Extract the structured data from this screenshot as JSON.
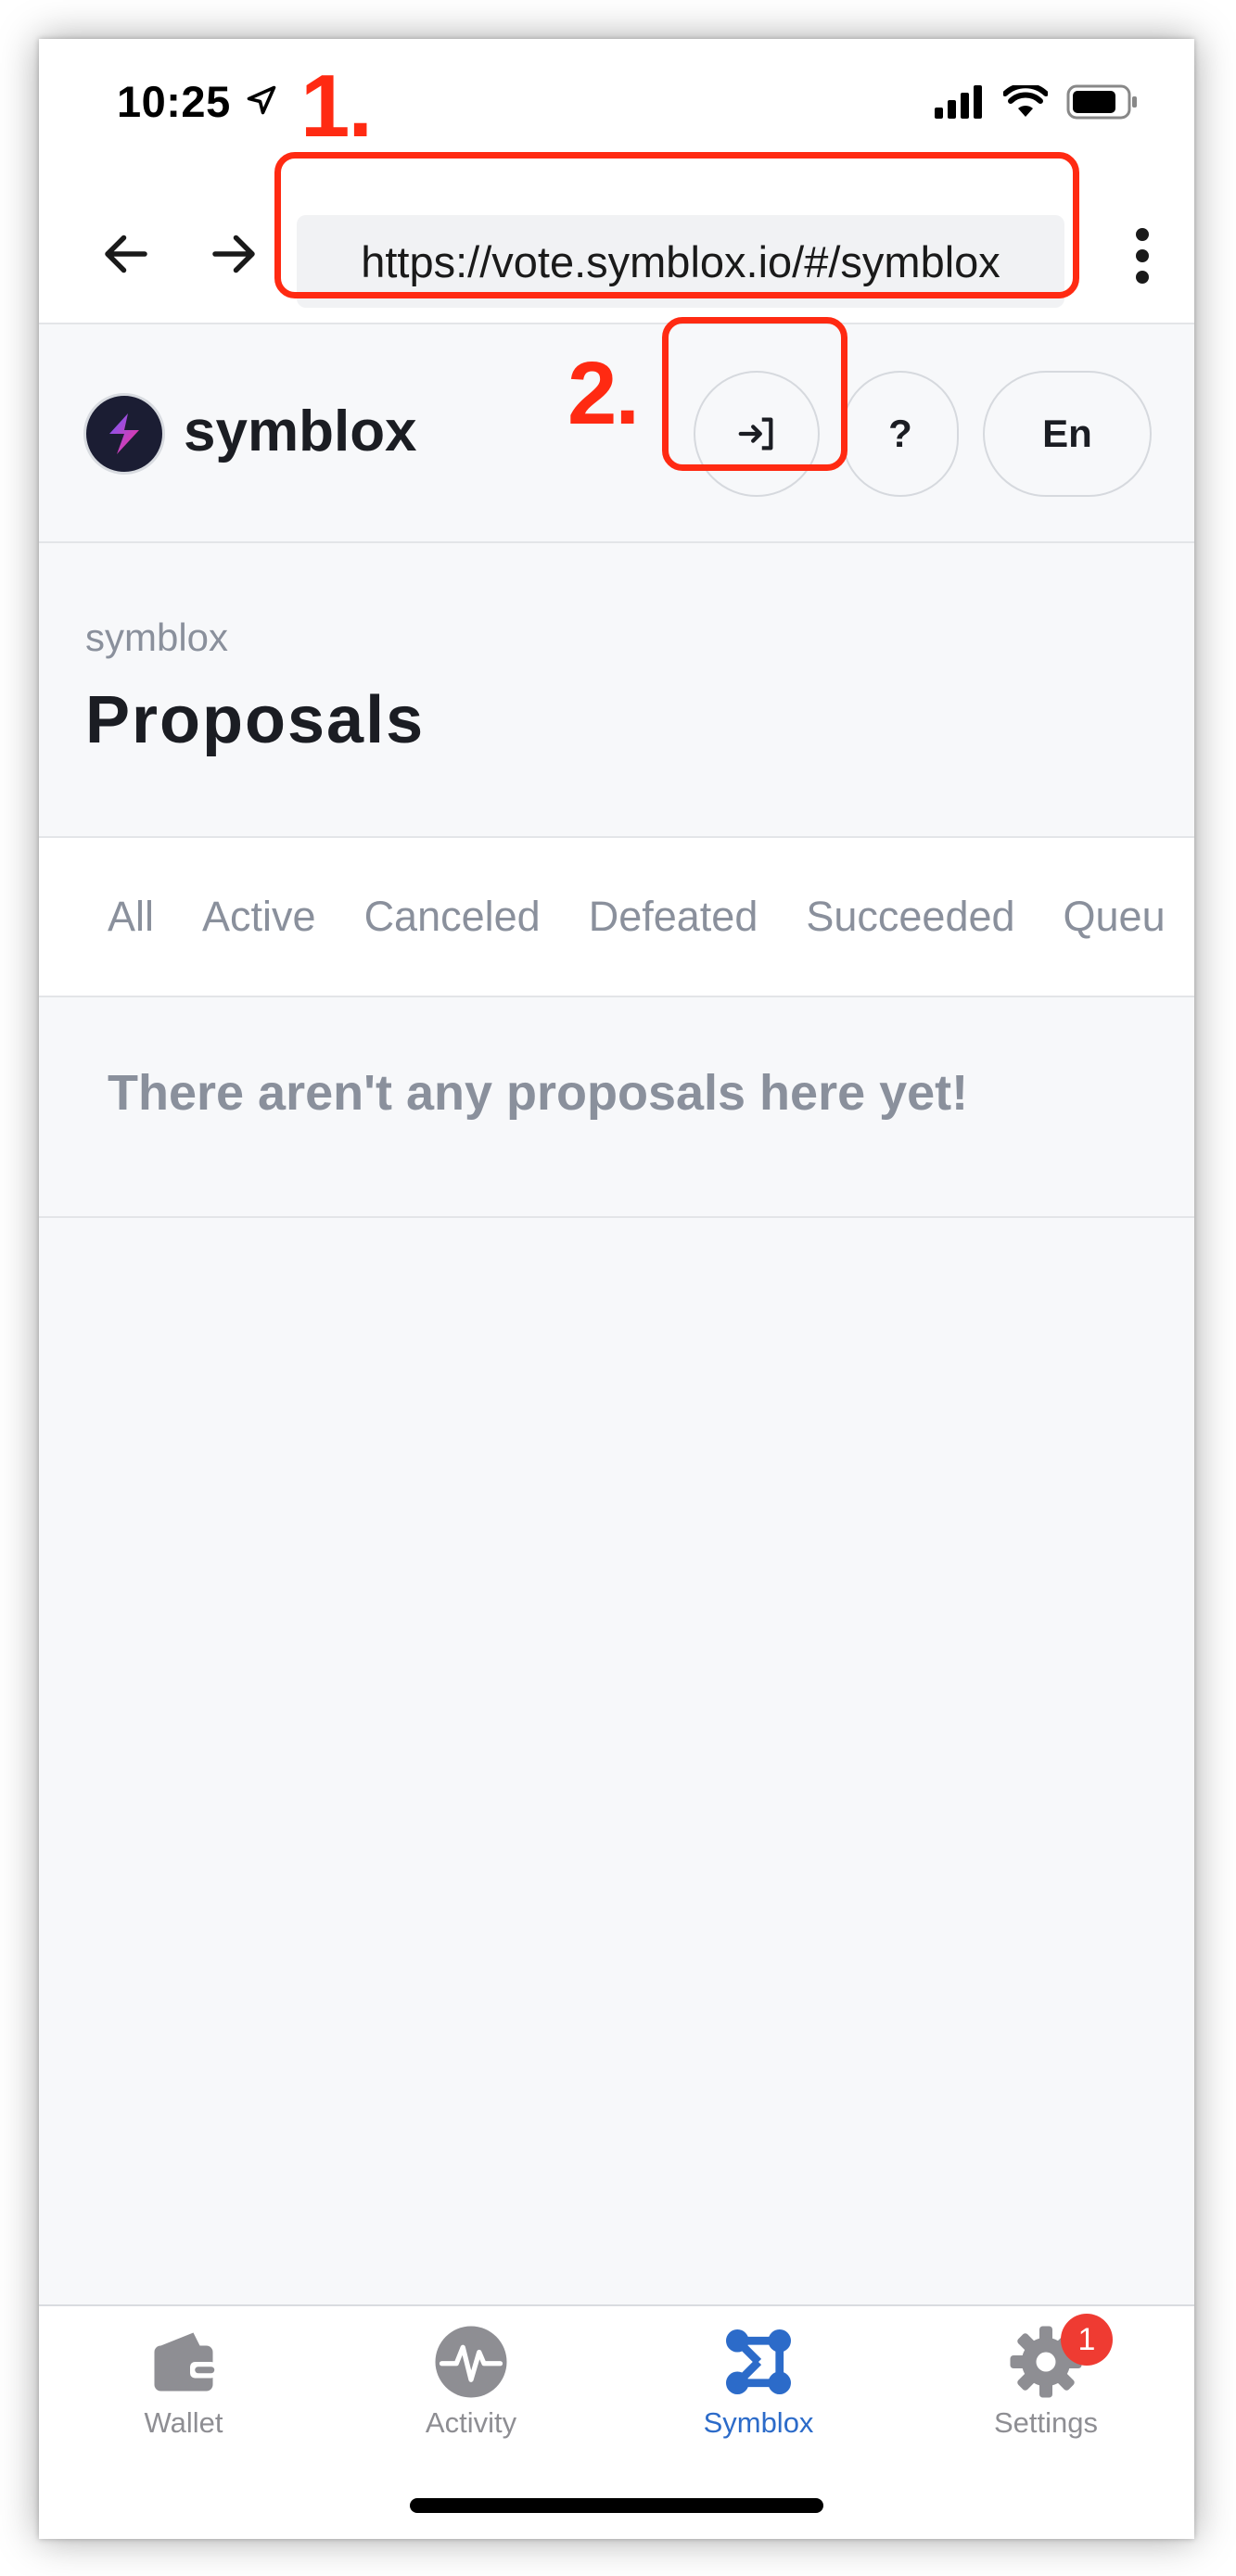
{
  "status": {
    "time": "10:25"
  },
  "browser": {
    "url": "https://vote.symblox.io/#/symblox"
  },
  "annotations": {
    "step1": "1.",
    "step2": "2."
  },
  "site": {
    "brand": "symblox",
    "help_label": "?",
    "lang_label": "En"
  },
  "page": {
    "breadcrumb": "symblox",
    "title": "Proposals",
    "empty_message": "There aren't any proposals here yet!"
  },
  "filters": [
    "All",
    "Active",
    "Canceled",
    "Defeated",
    "Succeeded",
    "Queu"
  ],
  "tabbar": {
    "items": [
      {
        "label": "Wallet",
        "icon": "wallet-icon"
      },
      {
        "label": "Activity",
        "icon": "activity-icon"
      },
      {
        "label": "Symblox",
        "icon": "symblox-icon",
        "active": true
      },
      {
        "label": "Settings",
        "icon": "gear-icon",
        "badge": "1"
      }
    ]
  },
  "colors": {
    "annotation": "#ff2a12",
    "active_tab": "#2c6bc9",
    "badge": "#ef3b32"
  }
}
